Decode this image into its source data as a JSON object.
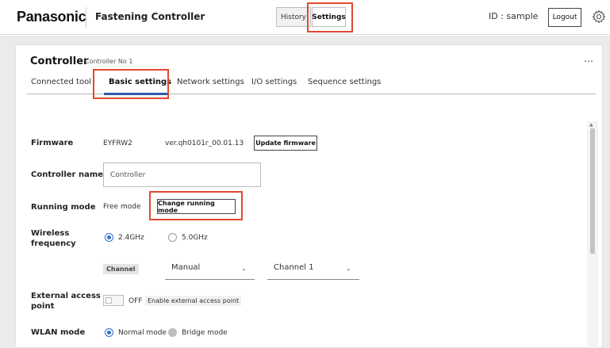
{
  "header": {
    "brand": "Panasonic",
    "app_title": "Fastening Controller",
    "history_label": "History",
    "settings_label": "Settings",
    "id_label": "ID : sample",
    "logout_label": "Logout",
    "settings_icon": "gear-icon"
  },
  "controller": {
    "title": "Controller",
    "subtitle": "Controller No 1",
    "more_label": "…"
  },
  "tabs": [
    {
      "label": "Connected tool",
      "active": false
    },
    {
      "label": "Basic settings",
      "active": true
    },
    {
      "label": "Network settings",
      "active": false
    },
    {
      "label": "I/O settings",
      "active": false
    },
    {
      "label": "Sequence settings",
      "active": false
    }
  ],
  "form": {
    "firmware": {
      "label": "Firmware",
      "model": "EYFRW2",
      "version": "ver.qh0101r_00.01.13",
      "button": "Update firmware"
    },
    "controller_name": {
      "label": "Controller name",
      "value": "Controller"
    },
    "running_mode": {
      "label": "Running mode",
      "value": "Free mode",
      "button": "Change running mode"
    },
    "wireless_frequency": {
      "label_line1": "Wireless",
      "label_line2": "frequency",
      "options": [
        "2.4GHz",
        "5.0GHz"
      ],
      "selected": "2.4GHz"
    },
    "channel": {
      "chip_label": "Channel",
      "mode_value": "Manual",
      "channel_value": "Channel 1"
    },
    "external_access_point": {
      "label_line1": "External access",
      "label_line2": "point",
      "toggle_state": "OFF",
      "toggle_text": "Enable external access point"
    },
    "wlan_mode": {
      "label": "WLAN mode",
      "options": [
        "Normal mode",
        "Bridge mode"
      ],
      "selected": "Normal mode"
    }
  },
  "colors": {
    "accent": "#2e5aac",
    "radio_selected": "#2f6fcf",
    "highlight_box": "#e2492f",
    "page_background": "#ebebeb"
  }
}
